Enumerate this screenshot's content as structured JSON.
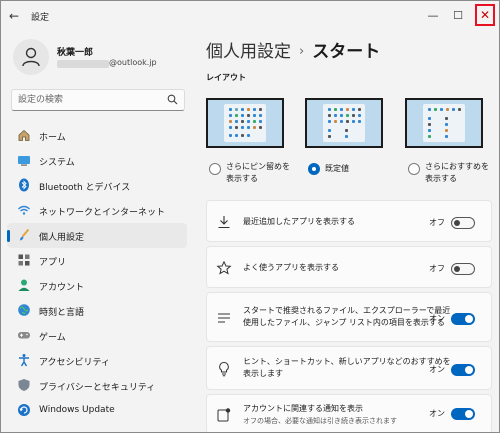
{
  "window": {
    "title": "設定",
    "back": "←",
    "minimize": "—",
    "maximize": "☐",
    "close": "✕"
  },
  "profile": {
    "name": "秋葉一郎",
    "email": "@outlook.jp"
  },
  "search": {
    "placeholder": "設定の検索"
  },
  "sidebar": {
    "items": [
      {
        "label": "ホーム",
        "icon": "home-icon"
      },
      {
        "label": "システム",
        "icon": "system-icon"
      },
      {
        "label": "Bluetooth とデバイス",
        "icon": "bluetooth-icon"
      },
      {
        "label": "ネットワークとインターネット",
        "icon": "wifi-icon"
      },
      {
        "label": "個人用設定",
        "icon": "brush-icon",
        "active": true
      },
      {
        "label": "アプリ",
        "icon": "apps-icon"
      },
      {
        "label": "アカウント",
        "icon": "account-icon"
      },
      {
        "label": "時刻と言語",
        "icon": "globe-icon"
      },
      {
        "label": "ゲーム",
        "icon": "gamepad-icon"
      },
      {
        "label": "アクセシビリティ",
        "icon": "accessibility-icon"
      },
      {
        "label": "プライバシーとセキュリティ",
        "icon": "shield-icon"
      },
      {
        "label": "Windows Update",
        "icon": "update-icon"
      }
    ]
  },
  "breadcrumb": {
    "parent": "個人用設定",
    "separator": "›",
    "current": "スタート"
  },
  "layout": {
    "heading": "レイアウト",
    "options": [
      {
        "line1": "さらにピン留めを",
        "line2": "表示する",
        "selected": false
      },
      {
        "line1": "既定値",
        "line2": "",
        "selected": true
      },
      {
        "line1": "さらにおすすめを",
        "line2": "表示する",
        "selected": false
      }
    ]
  },
  "settings": [
    {
      "line1": "最近追加したアプリを表示する",
      "line2": "",
      "state": "オフ",
      "on": false,
      "icon": "download-icon"
    },
    {
      "line1": "よく使うアプリを表示する",
      "line2": "",
      "state": "オフ",
      "on": false,
      "icon": "star-icon"
    },
    {
      "line1": "スタートで推奨されるファイル、エクスプローラーで最近",
      "line2": "使用したファイル、ジャンプ リスト内の項目を表示する",
      "state": "オン",
      "on": true,
      "icon": "list-icon"
    },
    {
      "line1": "ヒント、ショートカット、新しいアプリなどのおすすめを",
      "line2": "表示します",
      "state": "オン",
      "on": true,
      "icon": "lightbulb-icon"
    },
    {
      "line1": "アカウントに関連する通知を表示",
      "line2": "オフの場合、必要な通知は引き続き表示されます",
      "state": "オン",
      "on": true,
      "icon": "account-notification-icon"
    }
  ],
  "colors": {
    "accent": "#0067c0",
    "close_highlight": "#e81123"
  }
}
